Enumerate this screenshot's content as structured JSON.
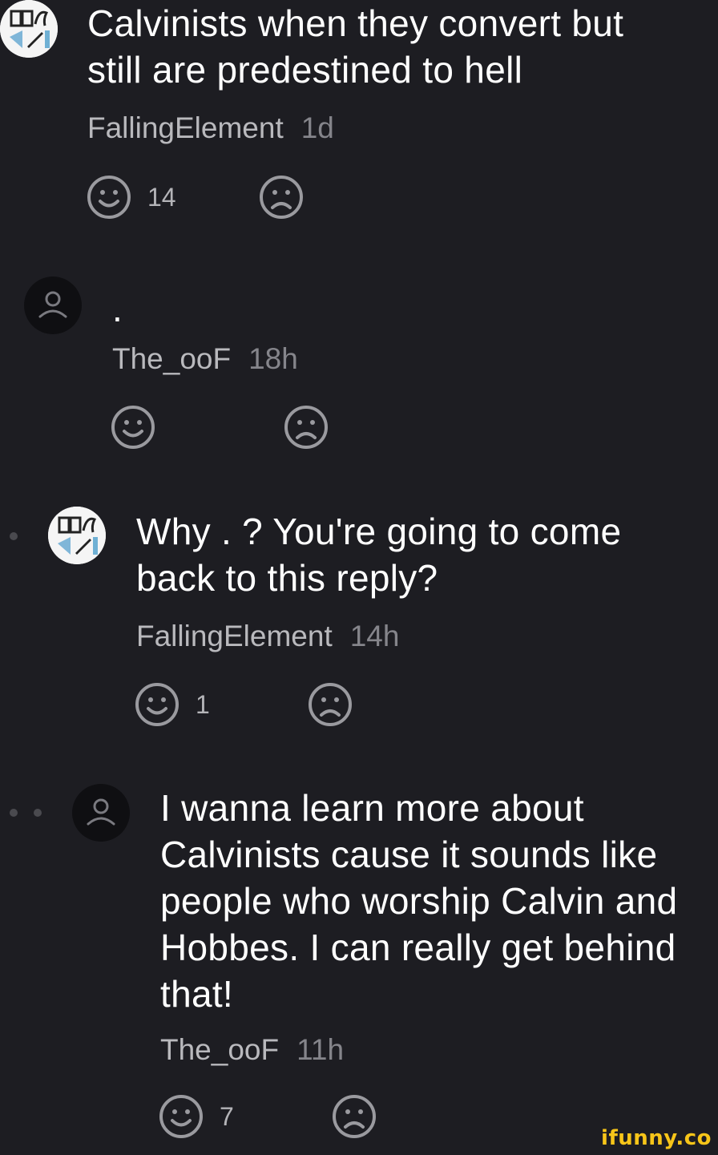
{
  "comments": [
    {
      "text_lines": [
        "Calvinists when they convert but",
        "still are predestined to hell"
      ],
      "user": "FallingElement",
      "time": "1d",
      "likes": "14",
      "avatar_icon": "book-logo-avatar"
    },
    {
      "text_lines": [
        "."
      ],
      "user": "The_ooF",
      "time": "18h",
      "likes": "",
      "avatar_icon": "default-user-avatar"
    },
    {
      "text_lines": [
        "Why . ? You're going to come",
        "back to this reply?"
      ],
      "user": "FallingElement",
      "time": "14h",
      "likes": "1",
      "avatar_icon": "book-logo-avatar"
    },
    {
      "text_lines": [
        "I wanna learn more about",
        "Calvinists cause it sounds like",
        "people who worship Calvin and",
        "Hobbes. I can really get behind",
        "that!"
      ],
      "user": "The_ooF",
      "time": "11h",
      "likes": "7",
      "avatar_icon": "default-user-avatar"
    }
  ],
  "watermark": "ifunny.co",
  "colors": {
    "background": "#1d1d22",
    "icon": "#9a9a9f",
    "accent": "#f7c519"
  }
}
